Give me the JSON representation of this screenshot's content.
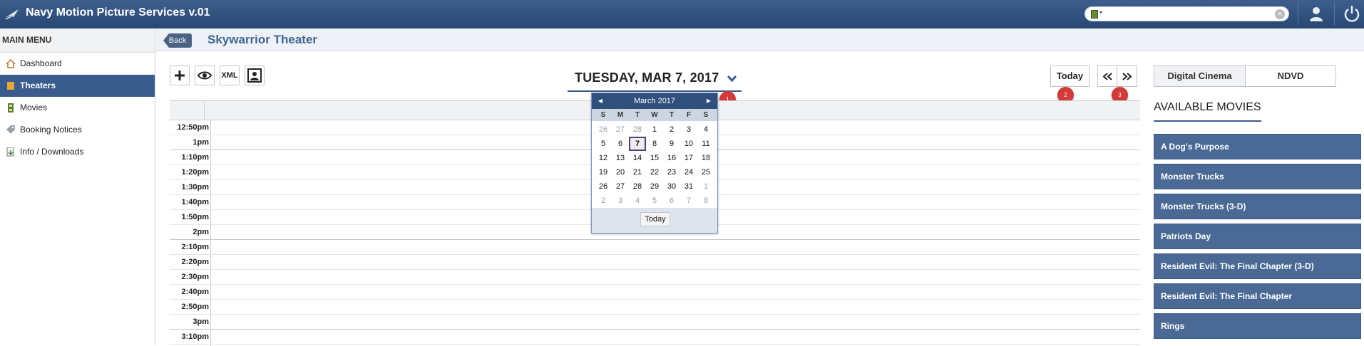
{
  "app": {
    "title": "Navy Motion Picture Services v.01"
  },
  "search": {
    "placeholder": "",
    "value": ""
  },
  "sidebar": {
    "header": "MAIN MENU",
    "items": [
      {
        "label": "Dashboard",
        "icon": "house-icon"
      },
      {
        "label": "Theaters",
        "icon": "ticket-icon",
        "active": true
      },
      {
        "label": "Movies",
        "icon": "film-icon"
      },
      {
        "label": "Booking Notices",
        "icon": "tag-icon"
      },
      {
        "label": "Info / Downloads",
        "icon": "download-doc-icon"
      }
    ]
  },
  "subheader": {
    "back_label": "Back",
    "theater_name": "Skywarrior Theater"
  },
  "toolbar": {
    "add_icon": "plus-icon",
    "view_icon": "eye-icon",
    "xml_label": "XML",
    "people_icon": "group-icon"
  },
  "schedule": {
    "date_title": "TUESDAY, MAR 7, 2017",
    "today_label": "Today",
    "badges": [
      "1",
      "2",
      "3"
    ],
    "times": [
      "12:50pm",
      "1pm",
      "1:10pm",
      "1:20pm",
      "1:30pm",
      "1:40pm",
      "1:50pm",
      "2pm",
      "2:10pm",
      "2:20pm",
      "2:30pm",
      "2:40pm",
      "2:50pm",
      "3pm",
      "3:10pm"
    ]
  },
  "datepicker": {
    "month_label": "March 2017",
    "weekdays": [
      "S",
      "M",
      "T",
      "W",
      "T",
      "F",
      "S"
    ],
    "days": [
      "26",
      "27",
      "28",
      "1",
      "2",
      "3",
      "4",
      "5",
      "6",
      "7",
      "8",
      "9",
      "10",
      "11",
      "12",
      "13",
      "14",
      "15",
      "16",
      "17",
      "18",
      "19",
      "20",
      "21",
      "22",
      "23",
      "24",
      "25",
      "26",
      "27",
      "28",
      "29",
      "30",
      "31",
      "1",
      "2",
      "3",
      "4",
      "5",
      "6",
      "7",
      "8"
    ],
    "selected": "7",
    "today_label": "Today"
  },
  "tabs": {
    "digital": "Digital Cinema",
    "ndvd": "NDVD"
  },
  "movies": {
    "heading": "AVAILABLE MOVIES",
    "items": [
      "A Dog's Purpose",
      "Monster Trucks",
      "Monster Trucks (3-D)",
      "Patriots Day",
      "Resident Evil: The Final Chapter (3-D)",
      "Resident Evil: The Final Chapter",
      "Rings"
    ]
  },
  "colors": {
    "header": "#2f4f7c",
    "accent": "#3a5c8c",
    "movie_button": "#4a6994",
    "badge": "#d33a3a"
  }
}
